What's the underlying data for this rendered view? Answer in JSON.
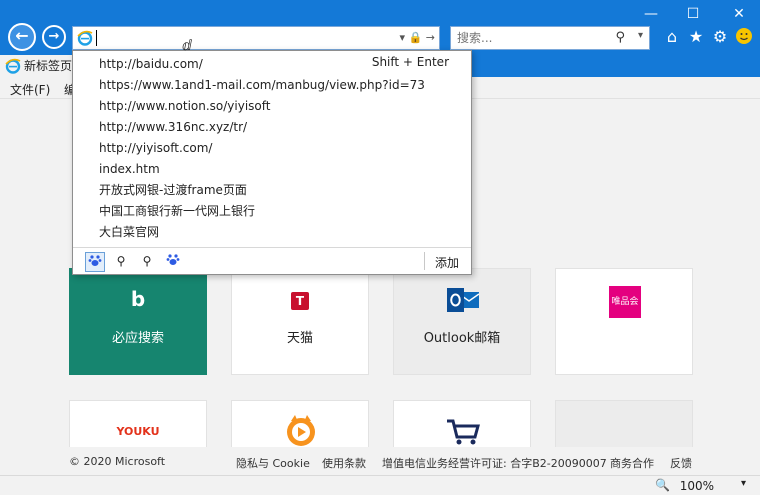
{
  "address": {
    "value": ""
  },
  "search": {
    "placeholder": "搜索..."
  },
  "tab": {
    "title": "新标签页"
  },
  "menubar": {
    "items": [
      "文件(F)",
      "编"
    ]
  },
  "dropdown": {
    "items": [
      "http://baidu.com/",
      "https://www.1and1-mail.com/manbug/view.php?id=73",
      "http://www.notion.so/yiyisoft",
      "http://www.316nc.xyz/tr/",
      "http://yiyisoft.com/",
      "index.htm",
      "开放式网银-过渡frame页面",
      "中国工商银行新一代网上银行",
      "大白菜官网"
    ],
    "shortcut": "Shift + Enter",
    "add_label": "添加"
  },
  "tiles": {
    "row1": [
      "必应搜索",
      "天猫",
      "Outlook邮箱",
      "唯品会"
    ],
    "youku": "YOUKU",
    "bing_logo": "b",
    "tmall_logo": "T"
  },
  "footer": {
    "copyright": "© 2020 Microsoft",
    "privacy": "隐私与 Cookie",
    "terms": "使用条款",
    "license": "增值电信业务经营许可证: 合字B2-20090007",
    "business": "商务合作",
    "feedback": "反馈"
  },
  "status": {
    "zoom": "100%"
  },
  "colors": {
    "chrome_blue": "#1479d7",
    "bing_green": "#16856f",
    "outlook_blue": "#0f6cbd",
    "vip_pink": "#e4007f",
    "tmall_red": "#c8102e"
  }
}
